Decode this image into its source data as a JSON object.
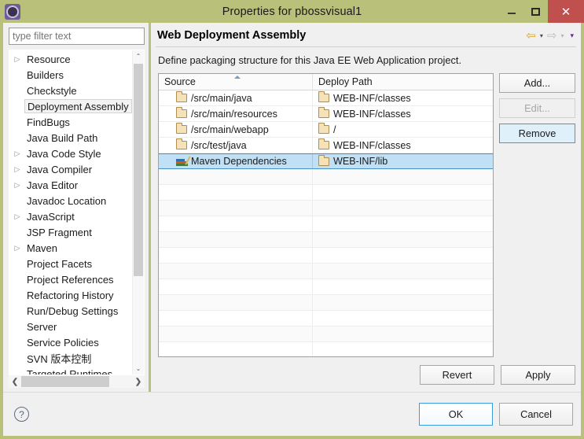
{
  "window": {
    "title": "Properties for pbossvisual1",
    "app_icon": "gear-icon",
    "minimize_label": "",
    "maximize_label": "",
    "close_label": "✕"
  },
  "filter": {
    "placeholder": "type filter text",
    "value": ""
  },
  "sidebar": {
    "items": [
      {
        "label": "Resource",
        "expandable": true,
        "selected": false
      },
      {
        "label": "Builders",
        "expandable": false,
        "selected": false
      },
      {
        "label": "Checkstyle",
        "expandable": false,
        "selected": false
      },
      {
        "label": "Deployment Assembly",
        "expandable": false,
        "selected": true
      },
      {
        "label": "FindBugs",
        "expandable": false,
        "selected": false
      },
      {
        "label": "Java Build Path",
        "expandable": false,
        "selected": false
      },
      {
        "label": "Java Code Style",
        "expandable": true,
        "selected": false
      },
      {
        "label": "Java Compiler",
        "expandable": true,
        "selected": false
      },
      {
        "label": "Java Editor",
        "expandable": true,
        "selected": false
      },
      {
        "label": "Javadoc Location",
        "expandable": false,
        "selected": false
      },
      {
        "label": "JavaScript",
        "expandable": true,
        "selected": false
      },
      {
        "label": "JSP Fragment",
        "expandable": false,
        "selected": false
      },
      {
        "label": "Maven",
        "expandable": true,
        "selected": false
      },
      {
        "label": "Project Facets",
        "expandable": false,
        "selected": false
      },
      {
        "label": "Project References",
        "expandable": false,
        "selected": false
      },
      {
        "label": "Refactoring History",
        "expandable": false,
        "selected": false
      },
      {
        "label": "Run/Debug Settings",
        "expandable": false,
        "selected": false
      },
      {
        "label": "Server",
        "expandable": false,
        "selected": false
      },
      {
        "label": "Service Policies",
        "expandable": false,
        "selected": false
      },
      {
        "label": "SVN 版本控制",
        "expandable": false,
        "selected": false
      },
      {
        "label": "Targeted Runtimes",
        "expandable": false,
        "selected": false
      }
    ],
    "scroll_up_glyph": "⌃",
    "scroll_down_glyph": "⌄",
    "scroll_left_glyph": "❮",
    "scroll_right_glyph": "❯"
  },
  "page": {
    "title": "Web Deployment Assembly",
    "description": "Define packaging structure for this Java EE Web Application project.",
    "nav": {
      "back_icon": "back-arrow-icon",
      "back_glyph": "⇦",
      "back_caret": "▾",
      "forward_icon": "forward-arrow-icon",
      "forward_glyph": "⇨",
      "forward_caret": "▾",
      "menu_caret": "▾"
    }
  },
  "table": {
    "columns": [
      "Source",
      "Deploy Path"
    ],
    "sort_column": "Source",
    "sort_direction": "asc",
    "rows": [
      {
        "source": "/src/main/java",
        "icon": "folder-icon",
        "deploy": "WEB-INF/classes",
        "selected": false
      },
      {
        "source": "/src/main/resources",
        "icon": "folder-icon",
        "deploy": "WEB-INF/classes",
        "selected": false
      },
      {
        "source": "/src/main/webapp",
        "icon": "folder-icon",
        "deploy": "/",
        "selected": false
      },
      {
        "source": "/src/test/java",
        "icon": "folder-icon",
        "deploy": "WEB-INF/classes",
        "selected": false
      },
      {
        "source": "Maven Dependencies",
        "icon": "books-icon",
        "deploy": "WEB-INF/lib",
        "selected": true
      }
    ]
  },
  "side_buttons": [
    {
      "label": "Add...",
      "state": "normal"
    },
    {
      "label": "Edit...",
      "state": "disabled"
    },
    {
      "label": "Remove",
      "state": "focused"
    }
  ],
  "apply_buttons": [
    {
      "label": "Revert"
    },
    {
      "label": "Apply"
    }
  ],
  "footer": {
    "help_icon": "help-icon",
    "help_glyph": "?",
    "buttons": [
      {
        "label": "OK",
        "primary": true
      },
      {
        "label": "Cancel",
        "primary": false
      }
    ]
  },
  "colors": {
    "titlebar": "#b8c07a",
    "close_button": "#c0504d",
    "selection": "#bfe0f5",
    "focus_border": "#3c9bdd",
    "back_arrow": "#d9a520",
    "app_icon": "#6f5b96"
  }
}
